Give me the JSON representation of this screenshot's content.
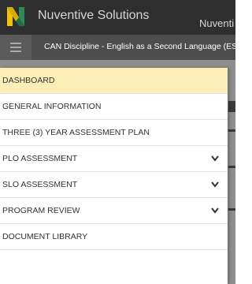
{
  "header": {
    "brand": "Nuventive Solutions",
    "brand_right": "Nuventi"
  },
  "subheader": {
    "context_title": "CAN Discipline - English as a Second Language (ES"
  },
  "nav": {
    "items": [
      {
        "label": "DASHBOARD",
        "active": true,
        "expandable": false
      },
      {
        "label": "GENERAL INFORMATION",
        "active": false,
        "expandable": false
      },
      {
        "label": "THREE (3) YEAR ASSESSMENT PLAN",
        "active": false,
        "expandable": false
      },
      {
        "label": "PLO ASSESSMENT",
        "active": false,
        "expandable": true
      },
      {
        "label": "SLO ASSESSMENT",
        "active": false,
        "expandable": true
      },
      {
        "label": "PROGRAM REVIEW",
        "active": false,
        "expandable": true
      },
      {
        "label": "DOCUMENT LIBRARY",
        "active": false,
        "expandable": false
      }
    ]
  },
  "colors": {
    "header_bg": "#2f2f2f",
    "subheader_bg": "#4d4d4d",
    "active_item_bg": "#fdeeb8",
    "logo_yellow": "#f2c400",
    "logo_green": "#2e8b57"
  }
}
